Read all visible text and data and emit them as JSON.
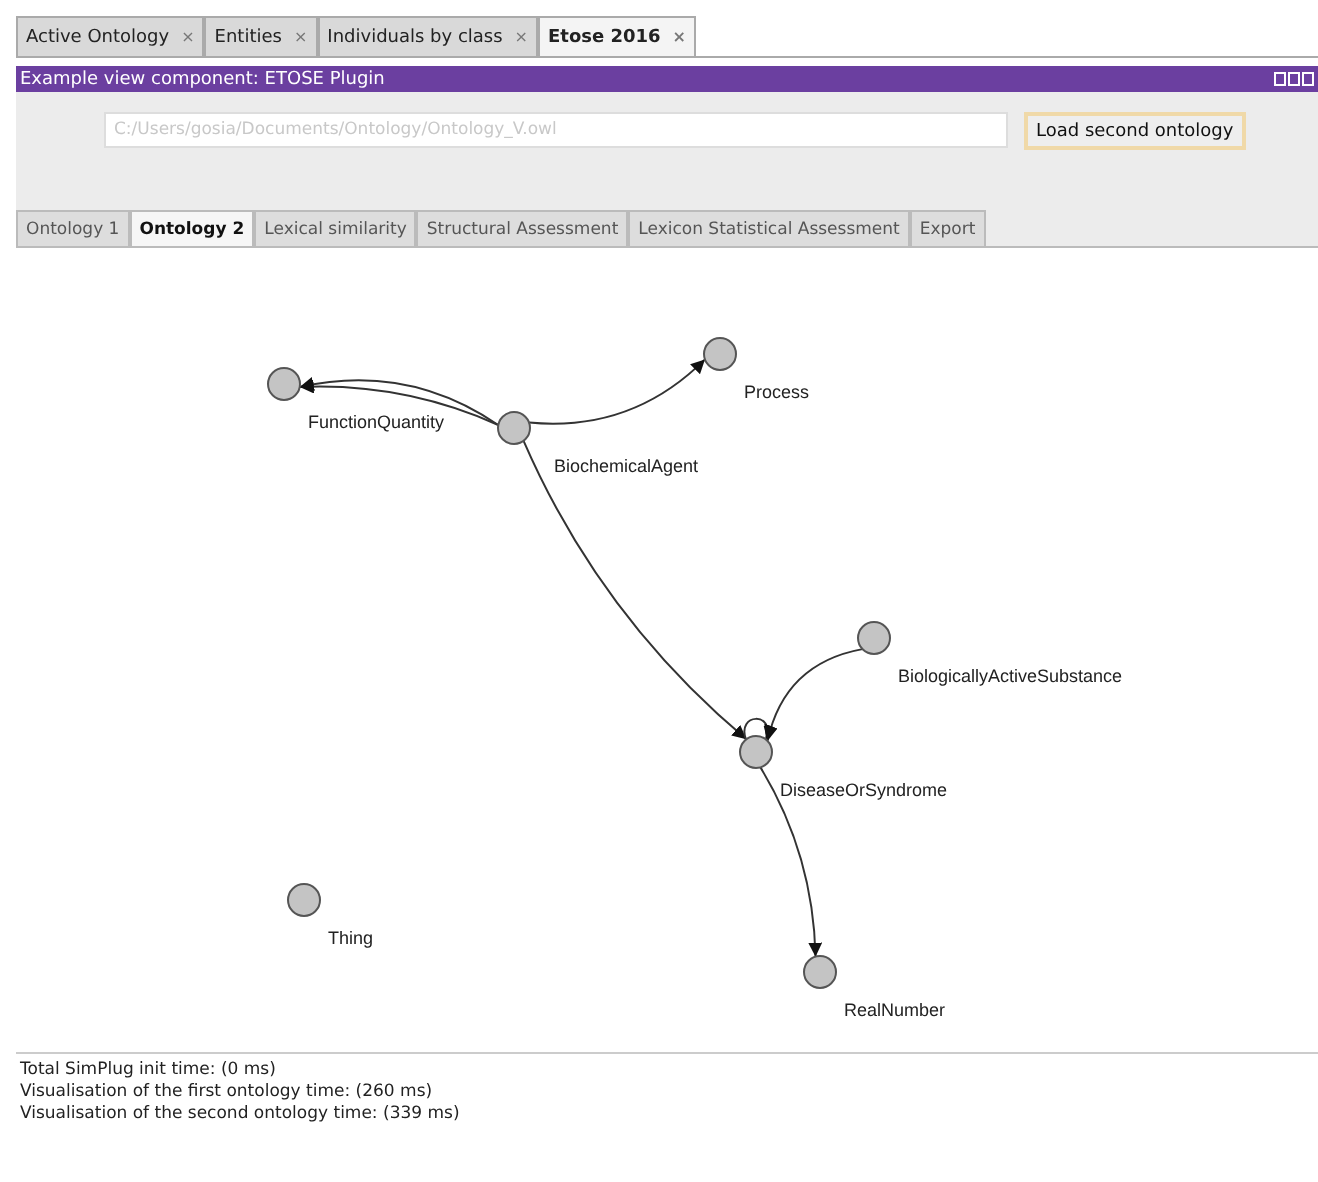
{
  "window_tabs": [
    {
      "label": "Active Ontology",
      "close": "×",
      "selected": false
    },
    {
      "label": "Entities",
      "close": "×",
      "selected": false
    },
    {
      "label": "Individuals by class",
      "close": "×",
      "selected": false
    },
    {
      "label": "Etose 2016",
      "close": "×",
      "selected": true
    }
  ],
  "view": {
    "title": "Example view component: ETOSE Plugin"
  },
  "path_field": {
    "placeholder": "C:/Users/gosia/Documents/Ontology/Ontology_V.owl"
  },
  "load_button": "Load second ontology",
  "tabs": [
    {
      "label": "Ontology 1",
      "selected": false
    },
    {
      "label": "Ontology 2",
      "selected": true
    },
    {
      "label": "Lexical similarity",
      "selected": false
    },
    {
      "label": "Structural Assessment",
      "selected": false
    },
    {
      "label": "Lexicon Statistical Assessment",
      "selected": false
    },
    {
      "label": "Export",
      "selected": false
    }
  ],
  "graph": {
    "nodes": [
      {
        "label": "FunctionQuantity"
      },
      {
        "label": "BiochemicalAgent"
      },
      {
        "label": "Process"
      },
      {
        "label": "BiologicallyActiveSubstance"
      },
      {
        "label": "DiseaseOrSyndrome"
      },
      {
        "label": "RealNumber"
      },
      {
        "label": "Thing"
      }
    ]
  },
  "log": [
    "Total SimPlug init time: (0 ms)",
    "Visualisation of the first ontology time: (260 ms)",
    "Visualisation of the second ontology time: (339 ms)"
  ]
}
